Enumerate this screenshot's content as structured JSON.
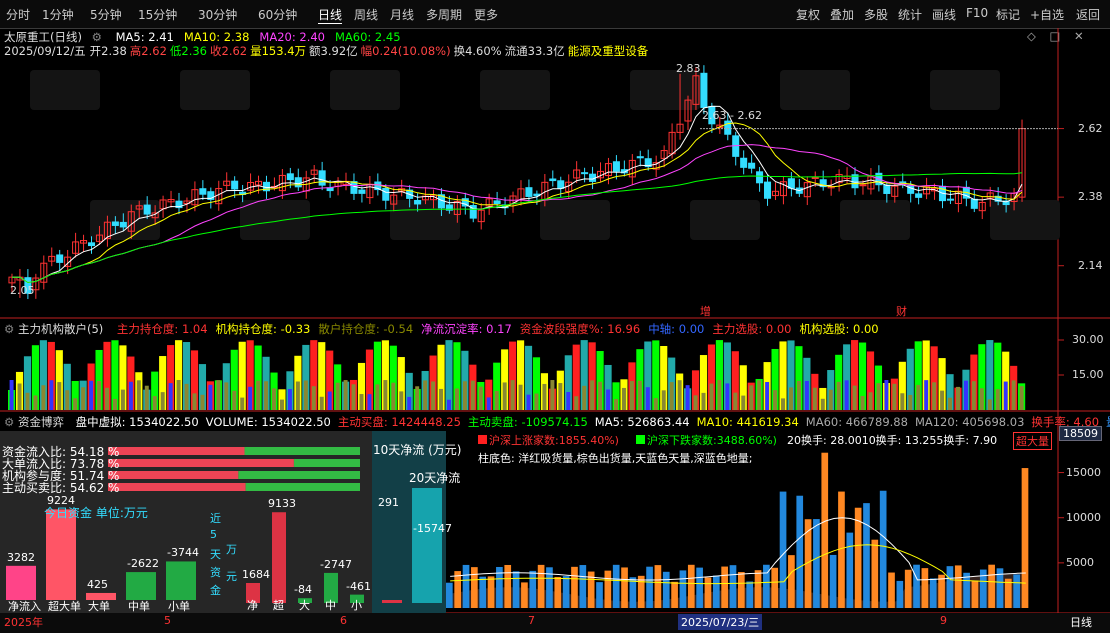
{
  "toolbar": {
    "left_items": [
      "分时",
      "1分钟",
      "5分钟",
      "15分钟",
      "30分钟",
      "60分钟",
      "日线",
      "周线",
      "月线",
      "多周期",
      "更多"
    ],
    "active_item": "日线",
    "right_items": [
      "复权",
      "叠加",
      "多股",
      "统计",
      "画线",
      "F10",
      "标记",
      "+自选",
      "返回"
    ]
  },
  "stock": {
    "name": "太原重工(日线)",
    "ma": [
      {
        "label": "MA5: 2.41",
        "color": "#ffffff"
      },
      {
        "label": "MA10: 2.38",
        "color": "#ffff00"
      },
      {
        "label": "MA20: 2.40",
        "color": "#ff44ff"
      },
      {
        "label": "MA60: 2.45",
        "color": "#00ff00"
      }
    ],
    "info_row": [
      {
        "text": "2025/09/12/五",
        "color": "#dddddd"
      },
      {
        "text": "开2.38",
        "color": "#dddddd"
      },
      {
        "text": "高2.62",
        "color": "#ff4444"
      },
      {
        "text": "低2.36",
        "color": "#00ff00"
      },
      {
        "text": "收2.62",
        "color": "#ff4444"
      },
      {
        "text": "量153.4万",
        "color": "#ffff00"
      },
      {
        "text": "额3.92亿",
        "color": "#dddddd"
      },
      {
        "text": "幅0.24(10.08%)",
        "color": "#ff4444"
      },
      {
        "text": "换4.60%",
        "color": "#dddddd"
      },
      {
        "text": "流通33.3亿",
        "color": "#dddddd"
      },
      {
        "text": "能源及重型设备",
        "color": "#ffff00"
      }
    ]
  },
  "price_axis": {
    "labels": [
      "2.62",
      "2.38",
      "2.14"
    ]
  },
  "annotations": {
    "high": "2.83",
    "low": "2.05",
    "range": "2.63 - 2.62",
    "mark1": "增",
    "mark2": "财"
  },
  "inst_panel": {
    "title": "主力机构散户(5)",
    "items": [
      {
        "text": "主力持仓度: 1.04",
        "color": "#ff3333"
      },
      {
        "text": "机构持仓度: -0.33",
        "color": "#ffff00"
      },
      {
        "text": "散户持仓度: -0.54",
        "color": "#888800"
      },
      {
        "text": "净流沉淀率: 0.17",
        "color": "#ff44ff"
      },
      {
        "text": "资金波段强度%: 16.96",
        "color": "#ff3333"
      },
      {
        "text": "中轴: 0.00",
        "color": "#3366ff"
      },
      {
        "text": "主力选股: 0.00",
        "color": "#ff3333"
      },
      {
        "text": "机构选股: 0.00",
        "color": "#ffff00"
      }
    ],
    "axis": [
      "30.00",
      "15.00"
    ]
  },
  "flow_panel": {
    "title": "资金博弈",
    "items": [
      {
        "text": "盘中虚拟: 1534022.50",
        "color": "#ffffff"
      },
      {
        "text": "VOLUME: 1534022.50",
        "color": "#ffffff"
      },
      {
        "text": "主动买盘: 1424448.25",
        "color": "#ff3333"
      },
      {
        "text": "主动卖盘: -109574.15",
        "color": "#00ff00"
      },
      {
        "text": "MA5: 526863.44",
        "color": "#ffffff"
      },
      {
        "text": "MA10: 441619.34",
        "color": "#ffff00"
      },
      {
        "text": "MA60: 466789.88",
        "color": "#aaaaaa"
      },
      {
        "text": "MA120: 405698.03",
        "color": "#aaaaaa"
      },
      {
        "text": "换手率: 4.60",
        "color": "#ff3333"
      },
      {
        "text": "量比",
        "color": "#3399ff"
      }
    ]
  },
  "vol_panel": {
    "legend1_up": "沪深上涨家数:1855.40%)",
    "legend1_down": "沪深下跌家数:3488.60%)",
    "legend_rest": "20换手: 28.0010换手: 13.255换手: 7.90",
    "legend_right": "超大量",
    "desc": "柱底色: 洋红吸货量,棕色出货量,天蓝色天量,深蓝色地量;",
    "current": "18509",
    "axis": [
      "15000",
      "10000",
      "5000"
    ]
  },
  "ratios": {
    "rows": [
      {
        "label": "资金流入比: 54.18 %",
        "value": 54.18
      },
      {
        "label": "大单流入比: 73.78 %",
        "value": 73.78
      },
      {
        "label": "机构参与度: 51.74 %",
        "value": 51.74
      },
      {
        "label": "主动买卖比: 54.62 %",
        "value": 54.62
      }
    ]
  },
  "today_funds": {
    "title": "今日资金 单位:万元",
    "categories": [
      "净流入",
      "超大单",
      "大单",
      "中单",
      "小单"
    ],
    "values": [
      3282,
      9224,
      425,
      -2622,
      -3744
    ],
    "value_labels": [
      "3282",
      "9224",
      "425",
      "-2622",
      "-3744"
    ],
    "colors": [
      "#ff4488",
      "#ff5566",
      "#ff5566",
      "#22aa44",
      "#22aa44"
    ]
  },
  "five_day": {
    "title_chars": [
      "近",
      "5",
      "天",
      "资",
      "金"
    ],
    "unit_chars": [
      "万",
      "元"
    ],
    "categories": [
      "净",
      "超",
      "大",
      "中",
      "小"
    ],
    "values": [
      1684,
      9133,
      -84,
      -2747,
      -461
    ],
    "value_labels": [
      "1684",
      "9133",
      "-84",
      "-2747",
      "-461"
    ]
  },
  "ten_day": {
    "title": "10天净流 (万元)",
    "value": 291,
    "label": "291"
  },
  "twenty_day": {
    "title": "20天净流",
    "value": -15747,
    "label": "-15747"
  },
  "date_axis": {
    "labels": [
      "2025年",
      "5",
      "6",
      "7",
      "2025/07/23/三",
      "9"
    ],
    "right": "日线"
  },
  "chart_data": {
    "type": "candlestick",
    "title": "太原重工(日线)",
    "last_bar": {
      "date": "2025/09/12",
      "open": 2.38,
      "high": 2.62,
      "low": 2.36,
      "close": 2.62,
      "volume": "153.4万"
    },
    "price_labels": [
      2.62,
      2.38,
      2.14
    ],
    "marked_high": 2.83,
    "marked_low": 2.05,
    "ma_values": {
      "MA5": 2.41,
      "MA10": 2.38,
      "MA20": 2.4,
      "MA60": 2.45
    },
    "today_funds_wan": {
      "categories": [
        "净流入",
        "超大单",
        "大单",
        "中单",
        "小单"
      ],
      "values": [
        3282,
        9224,
        425,
        -2622,
        -3744
      ]
    },
    "five_day_funds_wan": {
      "categories": [
        "净",
        "超",
        "大",
        "中",
        "小"
      ],
      "values": [
        1684,
        9133,
        -84,
        -2747,
        -461
      ]
    },
    "ten_day_net_wan": 291,
    "twenty_day_net_wan": -15747,
    "flow_ratios_pct": {
      "资金流入比": 54.18,
      "大单流入比": 73.78,
      "机构参与度": 51.74,
      "主动买卖比": 54.62
    }
  }
}
